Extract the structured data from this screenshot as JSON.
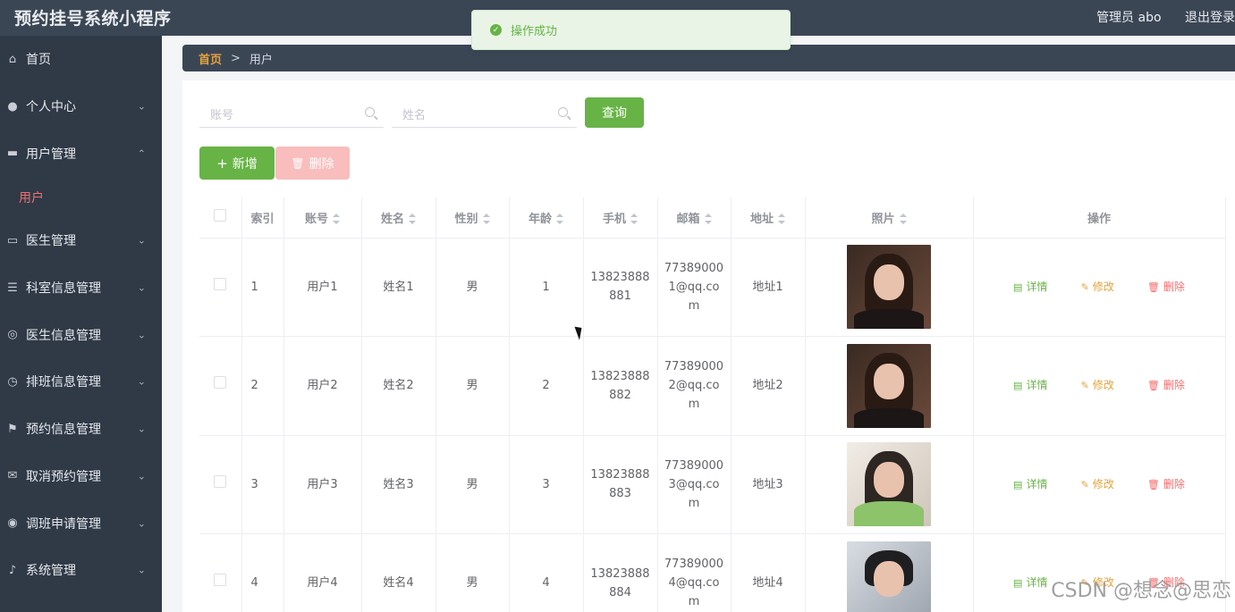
{
  "app": {
    "title": "预约挂号系统小程序"
  },
  "header": {
    "admin_label": "管理员 abo",
    "logout_label": "退出登录"
  },
  "sidebar": {
    "items": [
      {
        "label": "首页",
        "icon": "home-icon",
        "has_children": false
      },
      {
        "label": "个人中心",
        "icon": "user-icon",
        "has_children": true
      },
      {
        "label": "用户管理",
        "icon": "id-card-icon",
        "has_children": true,
        "expanded": true,
        "children": [
          "用户"
        ]
      },
      {
        "label": "医生管理",
        "icon": "doctor-card-icon",
        "has_children": true
      },
      {
        "label": "科室信息管理",
        "icon": "list-icon",
        "has_children": true
      },
      {
        "label": "医生信息管理",
        "icon": "lifebuoy-icon",
        "has_children": true
      },
      {
        "label": "排班信息管理",
        "icon": "clock-icon",
        "has_children": true
      },
      {
        "label": "预约信息管理",
        "icon": "flag-icon",
        "has_children": true
      },
      {
        "label": "取消预约管理",
        "icon": "mail-icon",
        "has_children": true
      },
      {
        "label": "调班申请管理",
        "icon": "compass-icon",
        "has_children": true
      },
      {
        "label": "系统管理",
        "icon": "microphone-icon",
        "has_children": true
      }
    ],
    "active_child": "用户"
  },
  "breadcrumb": {
    "home": "首页",
    "separator": ">",
    "current": "用户"
  },
  "search": {
    "account_placeholder": "账号",
    "name_placeholder": "姓名",
    "query_label": "查询"
  },
  "toolbar": {
    "add_label": "新增",
    "delete_label": "删除"
  },
  "toast": {
    "message": "操作成功"
  },
  "table": {
    "columns": [
      "索引",
      "账号",
      "姓名",
      "性别",
      "年龄",
      "手机",
      "邮箱",
      "地址",
      "照片",
      "操作"
    ],
    "rows": [
      {
        "index": "1",
        "account": "用户1",
        "name": "姓名1",
        "gender": "男",
        "age": "1",
        "phone": [
          "13823888",
          "881"
        ],
        "email": [
          "77389000",
          "1@qq.co",
          "m"
        ],
        "address": "地址1"
      },
      {
        "index": "2",
        "account": "用户2",
        "name": "姓名2",
        "gender": "男",
        "age": "2",
        "phone": [
          "13823888",
          "882"
        ],
        "email": [
          "77389000",
          "2@qq.co",
          "m"
        ],
        "address": "地址2"
      },
      {
        "index": "3",
        "account": "用户3",
        "name": "姓名3",
        "gender": "男",
        "age": "3",
        "phone": [
          "13823888",
          "883"
        ],
        "email": [
          "77389000",
          "3@qq.co",
          "m"
        ],
        "address": "地址3"
      },
      {
        "index": "4",
        "account": "用户4",
        "name": "姓名4",
        "gender": "男",
        "age": "4",
        "phone": [
          "13823888",
          "884"
        ],
        "email": [
          "77389000",
          "4@qq.co",
          "m"
        ],
        "address": "地址4"
      }
    ],
    "actions": {
      "detail": "详情",
      "edit": "修改",
      "delete": "删除"
    }
  },
  "watermark": "CSDN @想念@思恋",
  "colors": {
    "primary_green": "#67b346",
    "danger": "#f56c6c",
    "warning": "#e6a23c",
    "sidebar_bg": "#303a47",
    "header_bg": "#3b4655"
  }
}
